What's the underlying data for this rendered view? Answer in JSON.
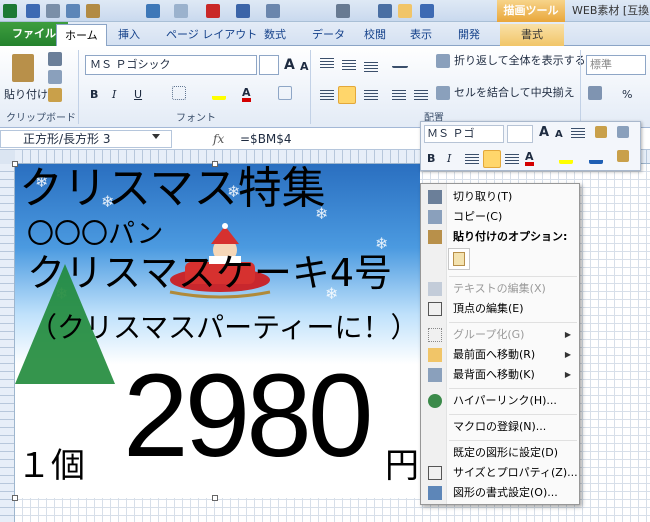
{
  "app": {
    "draw_tools_tab": "描画ツール",
    "window_title": "WEB素材 [互換"
  },
  "ribbon_tabs": [
    "ファイル",
    "ホーム",
    "挿入",
    "ページ レイアウト",
    "数式",
    "データ",
    "校閲",
    "表示",
    "開発",
    "書式"
  ],
  "home": {
    "paste_label": "貼り付け",
    "clipboard_group": "クリップボード",
    "font_group": "フォント",
    "alignment_group": "配置",
    "font_name": "ＭＳ Ｐゴシック",
    "wrap_text": "折り返して全体を表示する",
    "merge_center": "セルを結合して中央揃え",
    "number_format": "標準",
    "percent": "%"
  },
  "formula_bar": {
    "name_box": "正方形/長方形 3",
    "fx": "fx",
    "formula": "=$BM$4"
  },
  "mini_toolbar": {
    "font_name": "ＭＳ Ｐゴ"
  },
  "flyer": {
    "title": "クリスマス特集",
    "shop": "〇〇〇パン",
    "product": "クリスマスケーキ4号",
    "sub": "（クリスマスパーティーに！）",
    "unit": "１個",
    "price": "2980",
    "price_suffix": "円"
  },
  "context_menu": {
    "items": [
      {
        "label": "切り取り(T)",
        "disabled": false
      },
      {
        "label": "コピー(C)",
        "disabled": false
      },
      {
        "label": "貼り付けのオプション:",
        "disabled": false
      },
      {
        "label": "テキストの編集(X)",
        "disabled": true
      },
      {
        "label": "頂点の編集(E)",
        "disabled": false
      },
      {
        "label": "グループ化(G)",
        "disabled": true
      },
      {
        "label": "最前面へ移動(R)",
        "disabled": false
      },
      {
        "label": "最背面へ移動(K)",
        "disabled": false
      },
      {
        "label": "ハイパーリンク(H)...",
        "disabled": false
      },
      {
        "label": "マクロの登録(N)...",
        "disabled": false
      },
      {
        "label": "既定の図形に設定(D)",
        "disabled": false
      },
      {
        "label": "サイズとプロパティ(Z)...",
        "disabled": false
      },
      {
        "label": "図形の書式設定(O)...",
        "disabled": false
      }
    ]
  },
  "colors": {
    "file_tab": "#24822e",
    "highlight": "#ffd66b",
    "flyer_sky": "#2a6fc0"
  }
}
